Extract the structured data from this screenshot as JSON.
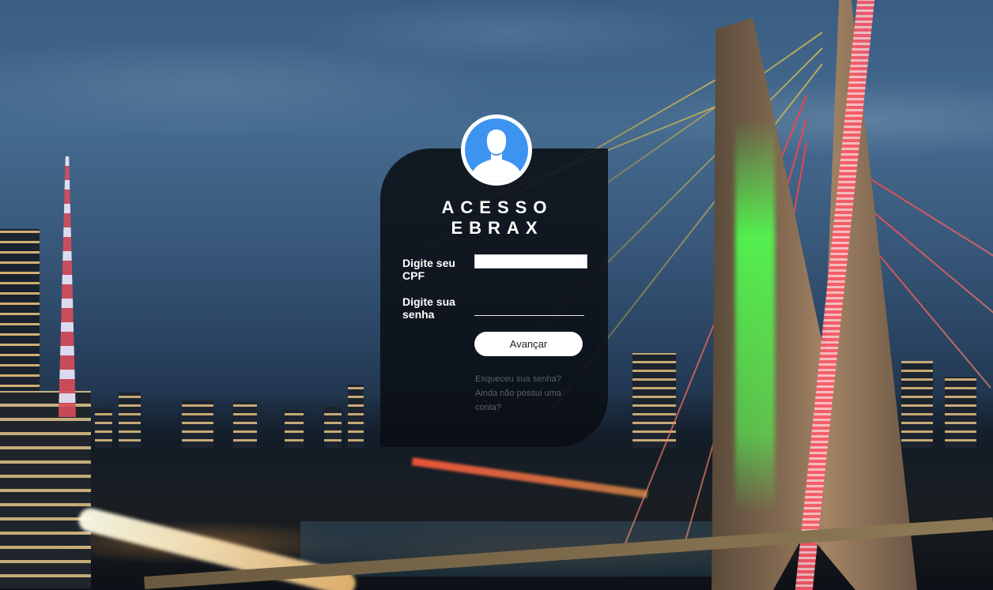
{
  "page": {
    "background_description_colors": {
      "card_background": "#0a0e14",
      "avatar_fill": "#3d94f0",
      "button_background": "#ffffff",
      "link_color": "#5a6068"
    }
  },
  "login": {
    "title_line1": "ACESSO",
    "title_line2": "EBRAX",
    "avatar_icon": "user-avatar-icon",
    "cpf_label": "Digite seu CPF",
    "cpf_value": "",
    "senha_label": "Digite sua senha",
    "senha_value": "",
    "submit_label": "Avançar",
    "forgot_link": "Esqueceu sua senha?",
    "register_link": "Ainda não possui uma conta?"
  }
}
